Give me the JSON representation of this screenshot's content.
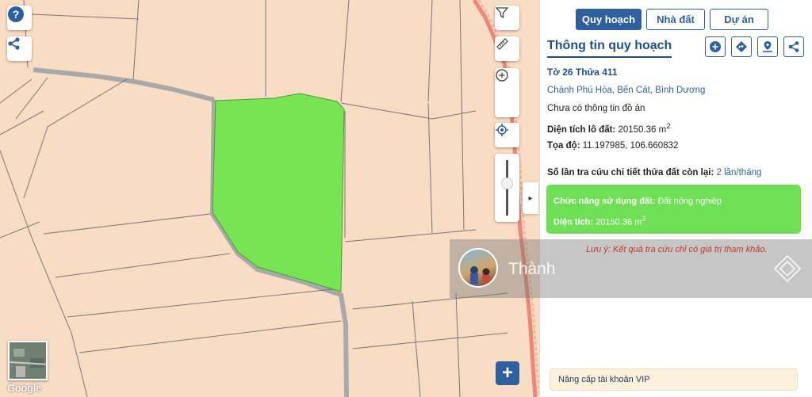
{
  "tabs": [
    {
      "label": "Quy hoạch",
      "active": true
    },
    {
      "label": "Nhà đất",
      "active": false
    },
    {
      "label": "Dự án",
      "active": false
    }
  ],
  "panel": {
    "title": "Thông tin quy hoạch",
    "parcel": "Tờ 26 Thửa 411",
    "location": "Chánh Phú Hòa, Bến Cát, Bình Dương",
    "plan_info": "Chưa có thông tin đồ án",
    "area_label": "Diện tích lô đất:",
    "area_value": "20150.36 m",
    "area_unit_sup": "2",
    "coord_label": "Tọa độ:",
    "coord_value": "11.197985, 106.660832",
    "lookup_label": "Số lần tra cứu chi tiết thửa đất còn lại:",
    "lookup_value": "2 lần/tháng",
    "land_use_label": "Chức năng sử dụng đất:",
    "land_use_value": "Đất nông nghiệp",
    "land_area_label": "Diện tích:",
    "land_area_value": "20150.36 m",
    "land_area_sup": "2",
    "note": "Lưu ý: Kết quả tra cứu chỉ có giá trị tham khảo.",
    "vip": "Nâng cấp tài khoản VIP",
    "actions": [
      "plus-circle-icon",
      "directions-icon",
      "map-pin-icon",
      "share-icon"
    ]
  },
  "overlay": {
    "name": "Thành"
  },
  "map": {
    "google_label": "Google",
    "colors": {
      "land": "#f8dcc3",
      "parcel_highlight": "#77e553",
      "road": "#a9a9a9",
      "accent": "#2e5f9e"
    }
  }
}
